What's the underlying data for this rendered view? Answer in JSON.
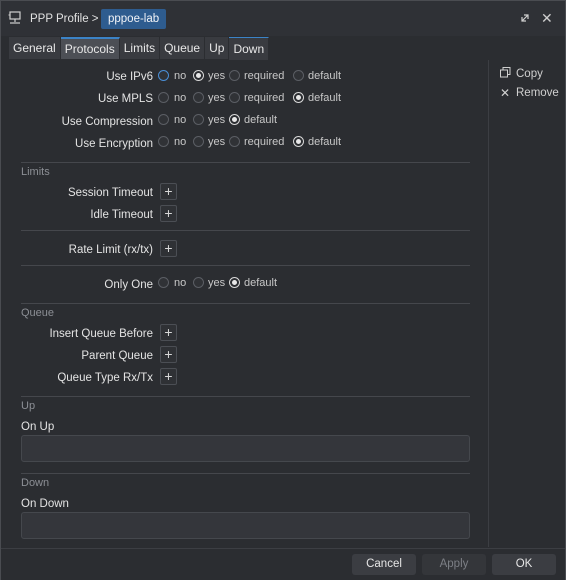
{
  "window": {
    "crumb": "PPP Profile >",
    "chip": "pppoe-lab",
    "icons": {
      "app": "network-device-icon",
      "restore": "restore-icon",
      "close": "close-icon"
    }
  },
  "tabs": [
    "General",
    "Protocols",
    "Limits",
    "Queue",
    "Up",
    "Down"
  ],
  "sidebar": {
    "copy": "Copy",
    "remove": "Remove"
  },
  "protocols": {
    "ipv6": {
      "label": "Use IPv6",
      "no": "no",
      "yes": "yes",
      "required": "required",
      "default": "default"
    },
    "mpls": {
      "label": "Use MPLS",
      "no": "no",
      "yes": "yes",
      "required": "required",
      "default": "default"
    },
    "compression": {
      "label": "Use Compression",
      "no": "no",
      "yes": "yes",
      "default": "default"
    },
    "encryption": {
      "label": "Use Encryption",
      "no": "no",
      "yes": "yes",
      "required": "required",
      "default": "default"
    }
  },
  "limits": {
    "section": "Limits",
    "session_timeout": "Session Timeout",
    "idle_timeout": "Idle Timeout",
    "rate_limit": "Rate Limit (rx/tx)",
    "only_one": {
      "label": "Only One",
      "no": "no",
      "yes": "yes",
      "default": "default"
    }
  },
  "queue": {
    "section": "Queue",
    "insert_before": "Insert Queue Before",
    "parent": "Parent Queue",
    "type": "Queue Type Rx/Tx"
  },
  "up": {
    "section": "Up",
    "on_up": "On Up",
    "value": ""
  },
  "down": {
    "section": "Down",
    "on_down": "On Down",
    "value": ""
  },
  "footer": {
    "cancel": "Cancel",
    "apply": "Apply",
    "ok": "OK"
  },
  "plus_glyph": "+"
}
